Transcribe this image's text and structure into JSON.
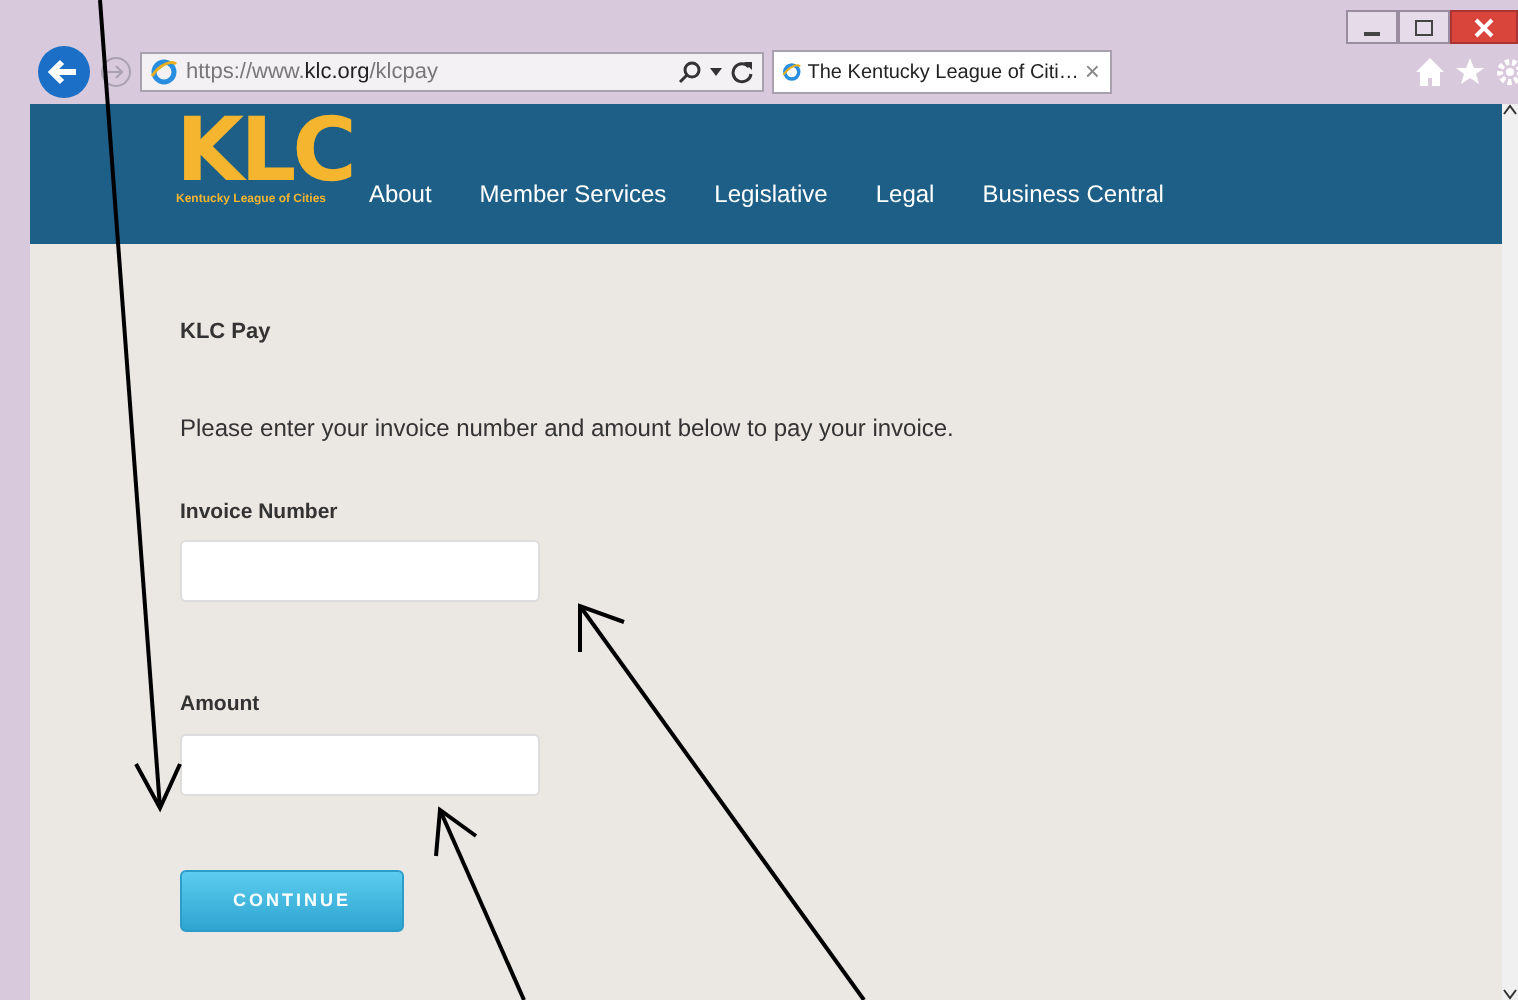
{
  "browser": {
    "window_controls": [
      {
        "kind": "minimize"
      },
      {
        "kind": "maximize"
      },
      {
        "kind": "close"
      }
    ],
    "address": {
      "url": "https://www.**klc.org**/klcpay"
    },
    "tab": {
      "title": "The Kentucky League of Citi…",
      "close": "×",
      "selected": true
    }
  },
  "site": {
    "logo": {
      "mark": "KLC",
      "tagline": "Kentucky League of Cities"
    },
    "nav": [
      "About",
      "Member Services",
      "Legislative",
      "Legal",
      "Business Central"
    ]
  },
  "form": {
    "heading": "KLC Pay",
    "intro": "Please enter your invoice number and amount below to pay your invoice.",
    "fields": [
      {
        "label": "Invoice Number"
      },
      {
        "label": "Amount"
      }
    ],
    "button": "CONTINUE"
  }
}
